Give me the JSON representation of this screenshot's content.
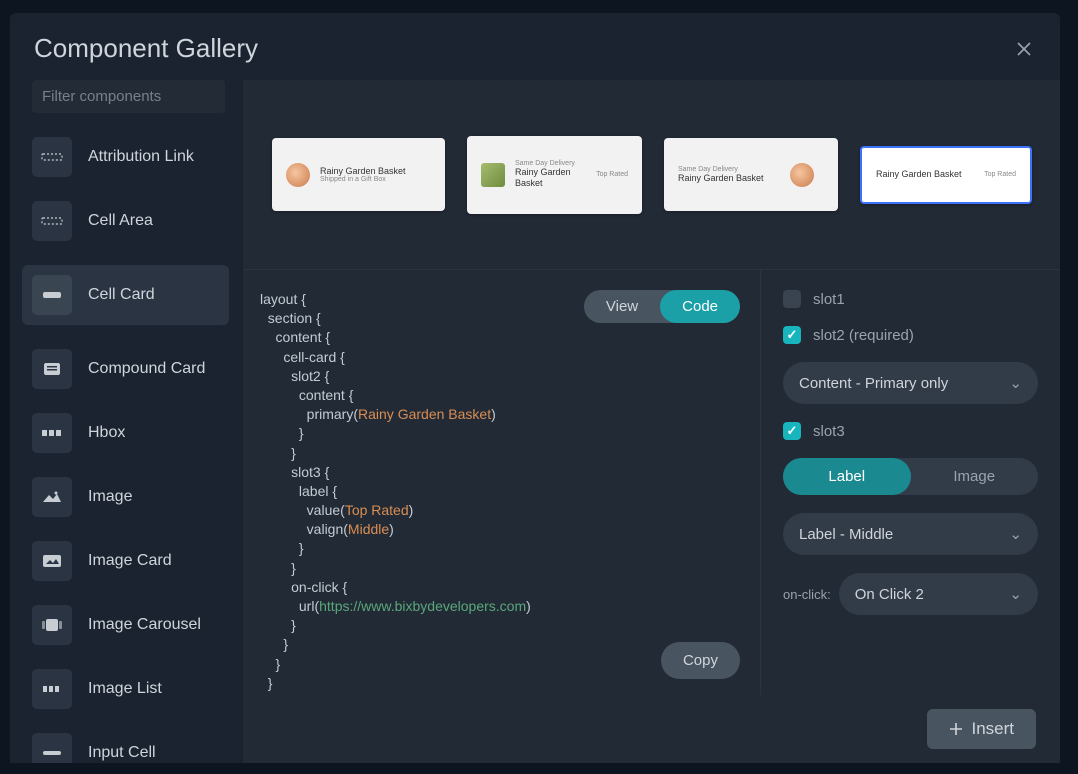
{
  "modal": {
    "title": "Component Gallery"
  },
  "search": {
    "placeholder": "Filter components"
  },
  "components": [
    {
      "label": "Attribution Link"
    },
    {
      "label": "Cell Area"
    },
    {
      "label": "Cell Card",
      "selected": true
    },
    {
      "label": "Compound Card"
    },
    {
      "label": "Hbox"
    },
    {
      "label": "Image"
    },
    {
      "label": "Image Card"
    },
    {
      "label": "Image Carousel"
    },
    {
      "label": "Image List"
    },
    {
      "label": "Input Cell"
    }
  ],
  "previews": {
    "p1": {
      "title": "Rainy Garden Basket",
      "sub": "Shipped in a Gift Box"
    },
    "p2": {
      "over": "Same Day Delivery",
      "title": "Rainy Garden Basket",
      "right": "Top Rated"
    },
    "p3": {
      "over": "Same Day Delivery",
      "title": "Rainy Garden Basket"
    },
    "p4": {
      "title": "Rainy Garden Basket",
      "right": "Top Rated"
    }
  },
  "toggle": {
    "view": "View",
    "code": "Code"
  },
  "code": {
    "l1": "layout {",
    "l2": "  section {",
    "l3": "    content {",
    "l4": "      cell-card {",
    "l5": "        slot2 {",
    "l6": "          content {",
    "l7a": "            primary(",
    "l7s": "Rainy Garden Basket",
    "l7b": ")",
    "l8": "          }",
    "l9": "        }",
    "l10": "        slot3 {",
    "l11": "          label {",
    "l12a": "            value(",
    "l12s": "Top Rated",
    "l12b": ")",
    "l13a": "            valign(",
    "l13s": "Middle",
    "l13b": ")",
    "l14": "          }",
    "l15": "        }",
    "l16": "        on-click {",
    "l17a": "          url(",
    "l17s": "https://www.bixbydevelopers.com",
    "l17b": ")",
    "l18": "        }",
    "l19": "      }",
    "l20": "    }",
    "l21": "  }",
    "l22": "}"
  },
  "copy": "Copy",
  "options": {
    "slot1": {
      "label": "slot1",
      "checked": false
    },
    "slot2": {
      "label": "slot2 (required)",
      "checked": true,
      "select": "Content - Primary only"
    },
    "slot3": {
      "label": "slot3",
      "checked": true,
      "labelBtn": "Label",
      "imageBtn": "Image",
      "select": "Label - Middle"
    },
    "onclick": {
      "label": "on-click:",
      "select": "On Click 2"
    }
  },
  "insert": "Insert"
}
